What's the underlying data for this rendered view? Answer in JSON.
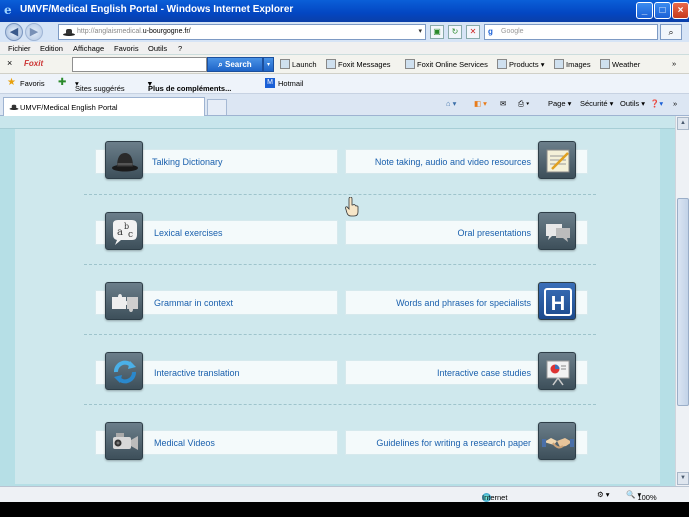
{
  "window": {
    "title": "UMVF/Medical English Portal - Windows Internet Explorer",
    "minimize": "_",
    "maximize": "□",
    "close": "×"
  },
  "address": {
    "url_prefix": "http://anglaismedical.",
    "url_host": "u-bourgogne.fr/",
    "search_placeholder": "Google",
    "google_icon": "g"
  },
  "menu": [
    "Fichier",
    "Edition",
    "Affichage",
    "Favoris",
    "Outils",
    "?"
  ],
  "foxit": {
    "close": "×",
    "brand": "Foxit",
    "search_button": "Search",
    "items": [
      "Launch",
      "Foxit Messages",
      "Foxit Online Services",
      "Products",
      "Images",
      "Weather"
    ]
  },
  "favorites": {
    "favoris": "Favoris",
    "suggested": "Sites suggérés",
    "more": "Plus de compléments...",
    "hotmail": "Hotmail"
  },
  "tab": {
    "label": "UMVF/Medical English Portal"
  },
  "commands": {
    "page": "Page",
    "security": "Sécurité",
    "tools": "Outils"
  },
  "portal": {
    "left": [
      {
        "label": "Talking Dictionary",
        "icon": "bowler-hat-icon"
      },
      {
        "label": "Lexical exercises",
        "icon": "abc-speech-bubble-icon"
      },
      {
        "label": "Grammar in context",
        "icon": "puzzle-pieces-icon"
      },
      {
        "label": "Interactive translation",
        "icon": "refresh-arrows-icon"
      },
      {
        "label": "Medical Videos",
        "icon": "video-camera-icon"
      }
    ],
    "right": [
      {
        "label": "Note taking, audio and video resources",
        "icon": "notepad-icon"
      },
      {
        "label": "Oral presentations",
        "icon": "speech-bubbles-icon"
      },
      {
        "label": "Words and phrases for specialists",
        "icon": "hospital-sign-icon"
      },
      {
        "label": "Interactive case studies",
        "icon": "presentation-board-icon"
      },
      {
        "label": "Guidelines for writing a research paper",
        "icon": "handshake-icon"
      }
    ]
  },
  "status": {
    "zone": "Internet",
    "zoom": "100%"
  }
}
